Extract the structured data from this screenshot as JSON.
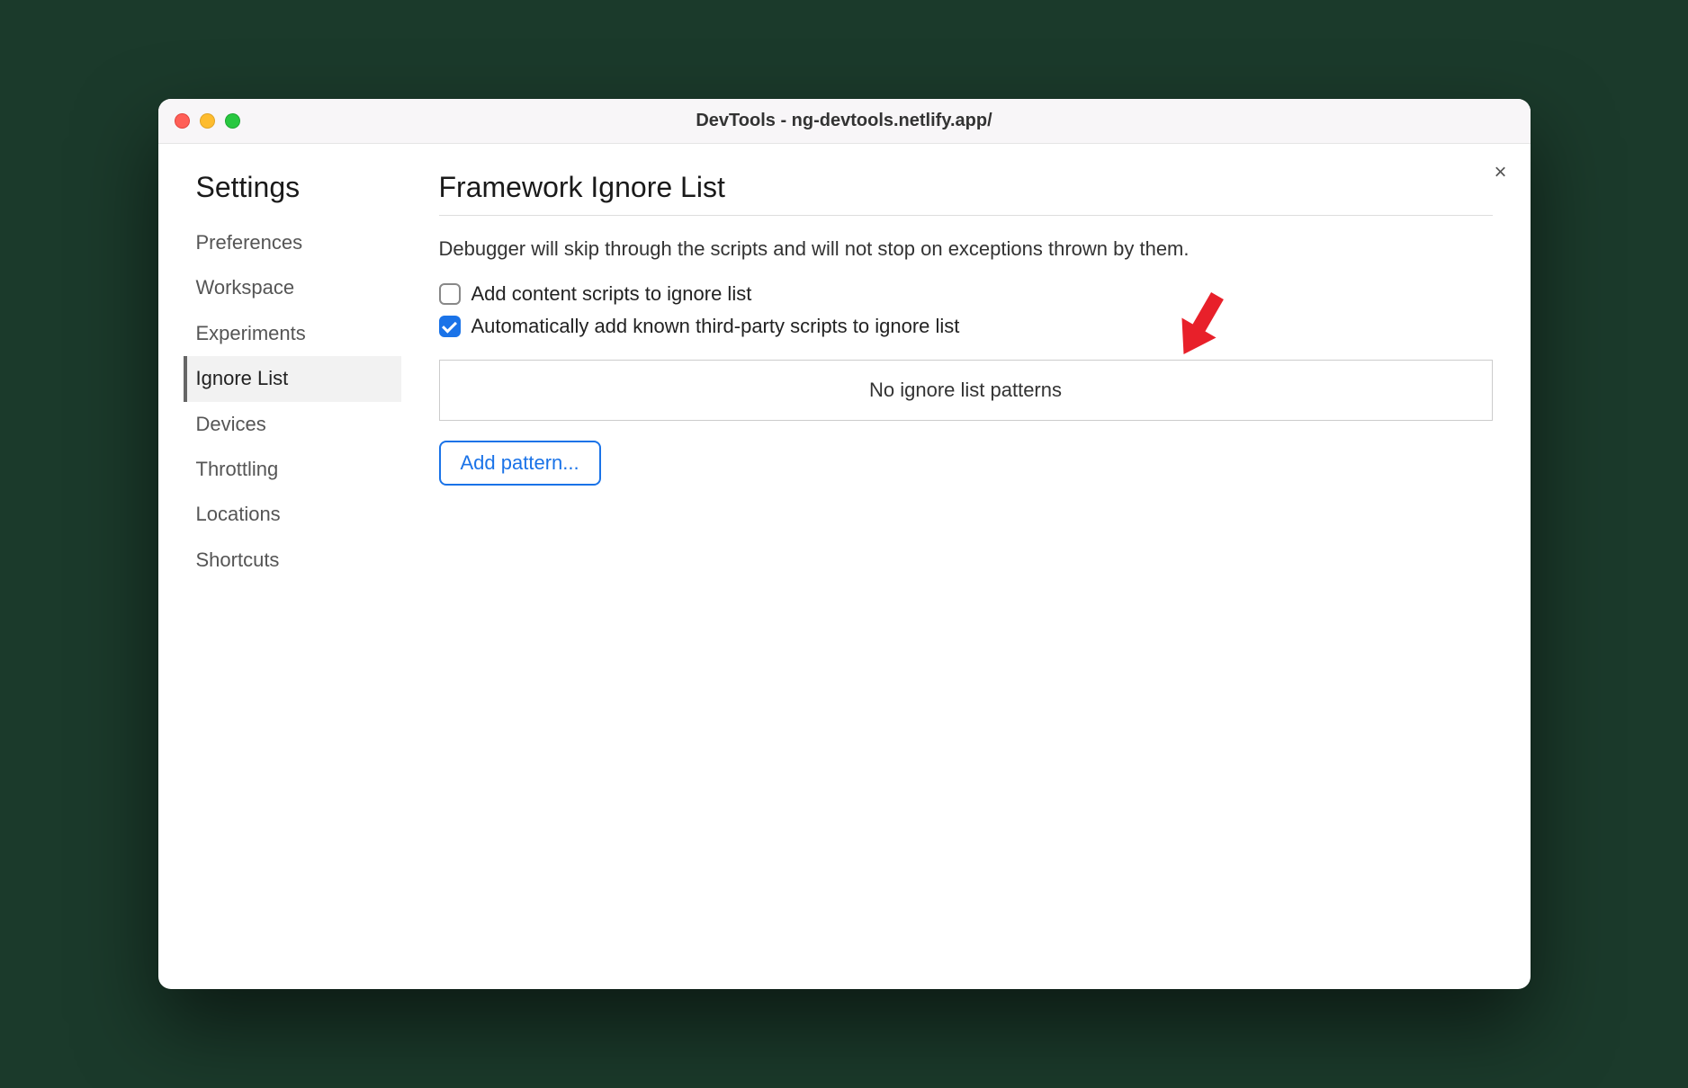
{
  "window": {
    "title": "DevTools - ng-devtools.netlify.app/"
  },
  "sidebar": {
    "title": "Settings",
    "items": [
      {
        "label": "Preferences",
        "active": false
      },
      {
        "label": "Workspace",
        "active": false
      },
      {
        "label": "Experiments",
        "active": false
      },
      {
        "label": "Ignore List",
        "active": true
      },
      {
        "label": "Devices",
        "active": false
      },
      {
        "label": "Throttling",
        "active": false
      },
      {
        "label": "Locations",
        "active": false
      },
      {
        "label": "Shortcuts",
        "active": false
      }
    ]
  },
  "panel": {
    "title": "Framework Ignore List",
    "description": "Debugger will skip through the scripts and will not stop on exceptions thrown by them.",
    "option_content_scripts": {
      "label": "Add content scripts to ignore list",
      "checked": false
    },
    "option_third_party": {
      "label": "Automatically add known third-party scripts to ignore list",
      "checked": true
    },
    "empty_text": "No ignore list patterns",
    "add_button": "Add pattern..."
  },
  "close_label": "×"
}
